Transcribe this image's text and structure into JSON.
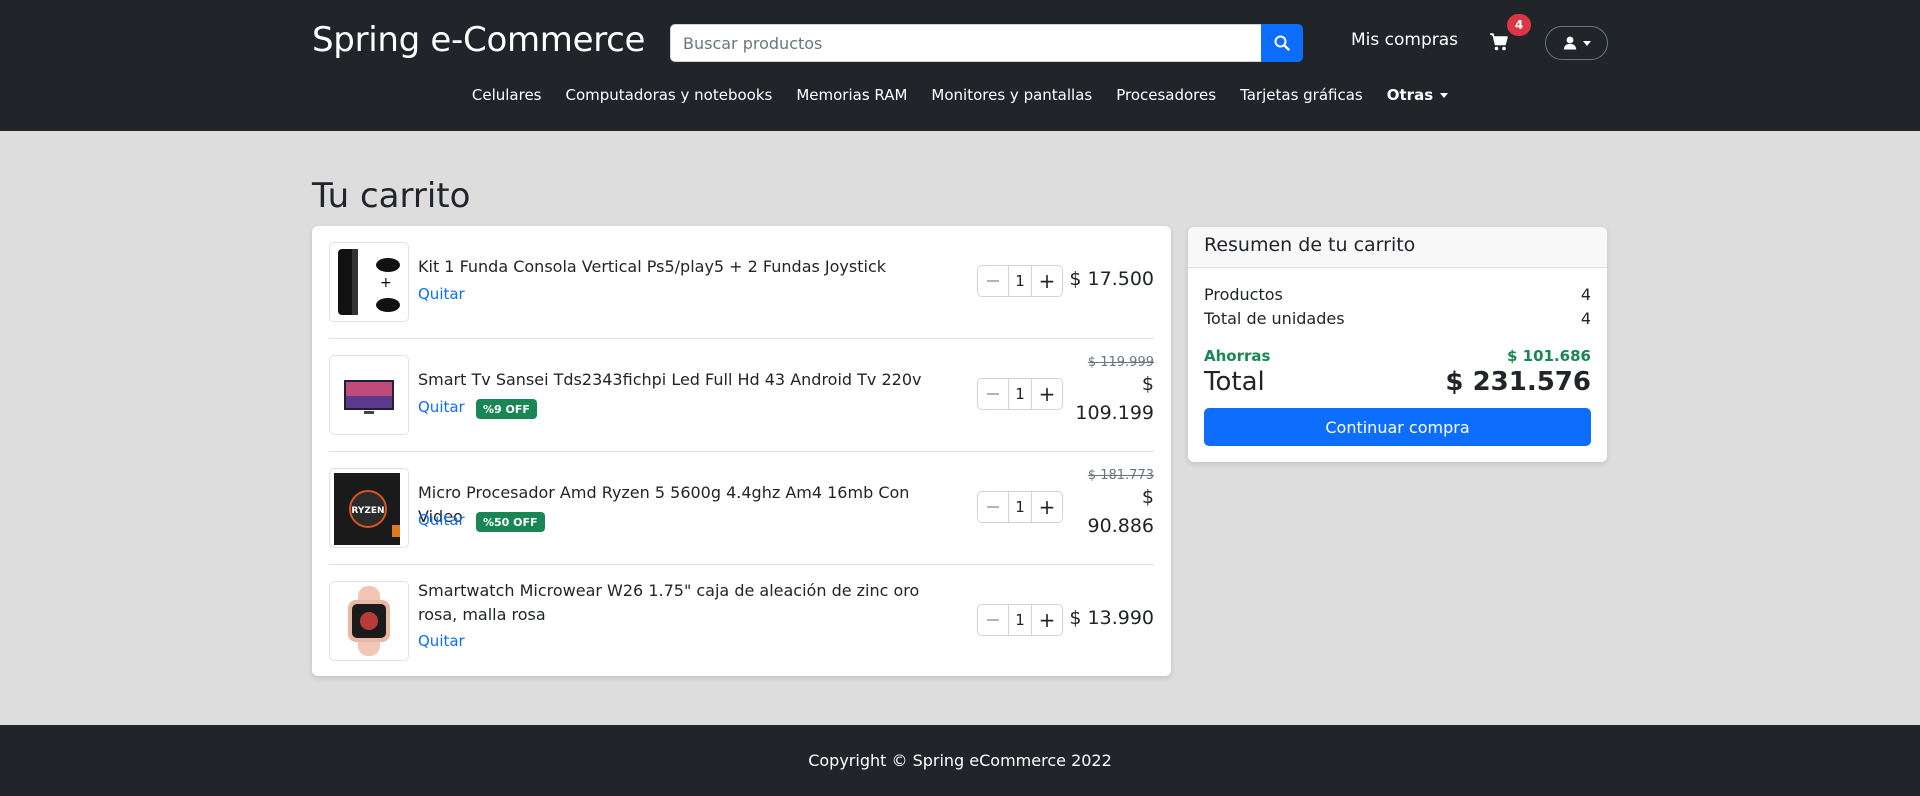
{
  "header": {
    "brand": "Spring e-Commerce",
    "search_placeholder": "Buscar productos",
    "mis_compras": "Mis compras",
    "cart_count": "4",
    "categories": [
      "Celulares",
      "Computadoras y notebooks",
      "Memorias RAM",
      "Monitores y pantallas",
      "Procesadores",
      "Tarjetas gráficas"
    ],
    "otras": "Otras"
  },
  "page_title": "Tu carrito",
  "cart": {
    "items": [
      {
        "title": "Kit 1 Funda Consola Vertical Ps5/play5 + 2 Fundas Joystick",
        "remove": "Quitar",
        "qty": "1",
        "price": "$ 17.500"
      },
      {
        "title": "Smart Tv Sansei Tds2343fichpi Led Full Hd 43 Android Tv 220v",
        "remove": "Quitar",
        "discount": "%9 OFF",
        "qty": "1",
        "old_price": "$ 119.999",
        "price": "$ 109.199"
      },
      {
        "title": "Micro Procesador Amd Ryzen 5 5600g 4.4ghz Am4 16mb Con Video",
        "remove": "Quitar",
        "discount": "%50 OFF",
        "qty": "1",
        "old_price": "$ 181.773",
        "price": "$ 90.886"
      },
      {
        "title": "Smartwatch Microwear W26 1.75\" caja de aleación de zinc oro rosa, malla rosa",
        "remove": "Quitar",
        "qty": "1",
        "price": "$ 13.990"
      }
    ]
  },
  "summary": {
    "title": "Resumen de tu carrito",
    "productos_label": "Productos",
    "productos_value": "4",
    "unidades_label": "Total de unidades",
    "unidades_value": "4",
    "ahorras_label": "Ahorras",
    "ahorras_value": "$ 101.686",
    "total_label": "Total",
    "total_value": "$ 231.576",
    "button": "Continuar compra"
  },
  "footer": {
    "copyright": "Copyright © Spring eCommerce 2022"
  },
  "colors": {
    "dark": "#212529",
    "primary": "#0d6efd",
    "success": "#198754",
    "danger": "#dc3545",
    "background": "#dddddd"
  }
}
